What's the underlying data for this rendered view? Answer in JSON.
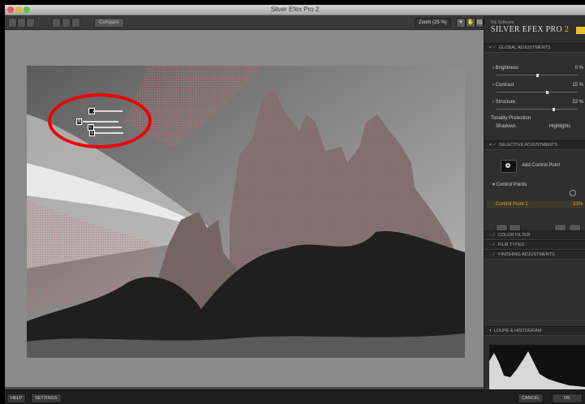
{
  "window": {
    "title": "Silver Efex Pro 2"
  },
  "toolbar": {
    "compare_label": "Compare",
    "zoom_label": "Zoom (25 %)"
  },
  "control_point": {
    "tags": [
      "B",
      "C",
      "S"
    ]
  },
  "panel": {
    "brand_sub": "Nik Software",
    "brand_main": "SILVER EFEX PRO",
    "brand_version": "2",
    "global": {
      "header": "GLOBAL ADJUSTMENTS",
      "rows": [
        {
          "label": "Brightness",
          "value": "0 %",
          "level": 0.5
        },
        {
          "label": "Contrast",
          "value": "15 %",
          "level": 0.62
        },
        {
          "label": "Structure",
          "value": "22 %",
          "level": 0.7
        }
      ],
      "tonality": "Tonality Protection",
      "shadows": "Shadows",
      "highlights": "Highlights"
    },
    "selective": {
      "header": "SELECTIVE ADJUSTMENTS",
      "add_cp": "Add Control Point",
      "cp_header": "Control Points",
      "cp_item": "Control Point 1",
      "cp_value": "33%"
    },
    "sections": {
      "color_filter": "COLOR FILTER",
      "film_types": "FILM TYPES",
      "finishing": "FINISHING ADJUSTMENTS",
      "loupe": "LOUPE & HISTOGRAM"
    }
  },
  "bottom": {
    "help": "HELP",
    "settings": "SETTINGS",
    "cancel": "CANCEL",
    "ok": "OK"
  }
}
